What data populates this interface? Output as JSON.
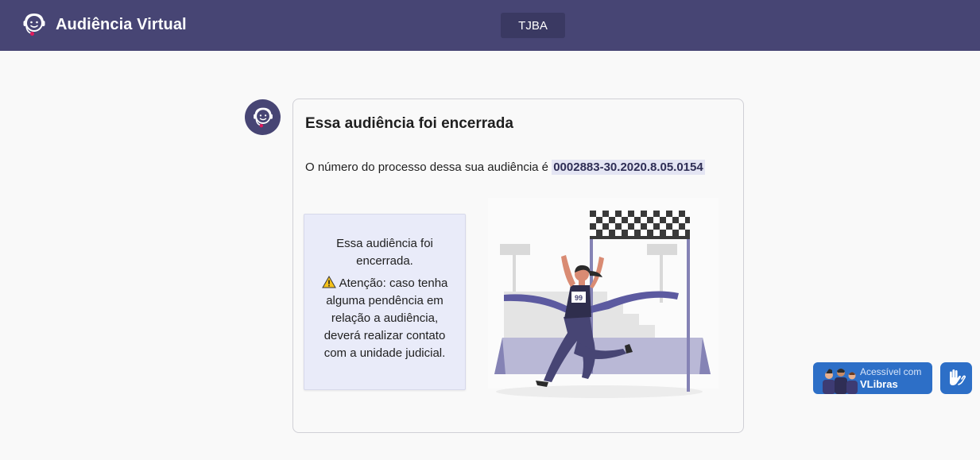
{
  "header": {
    "app_title": "Audiência Virtual",
    "org_button": "TJBA",
    "logo_icon": "headset-smile-icon",
    "background": "#474574"
  },
  "card": {
    "title": "Essa audiência foi encerrada",
    "process_text": "O número do processo dessa sua audiência é",
    "process_number": "0002883-30.2020.8.05.0154",
    "notice": {
      "line1": "Essa audiência foi encerrada.",
      "warning_icon": "warning-icon",
      "warning_text": "Atenção: caso tenha alguma pendência em relação a audiência, deverá realizar contato com a unidade judicial."
    },
    "illustration": {
      "bib_number": "99"
    }
  },
  "accessibility": {
    "vlibras_small": "Acessível com",
    "vlibras_big": "VLibras",
    "hands_icon": "sign-language-hands-icon",
    "color": "#2d6fc7"
  }
}
